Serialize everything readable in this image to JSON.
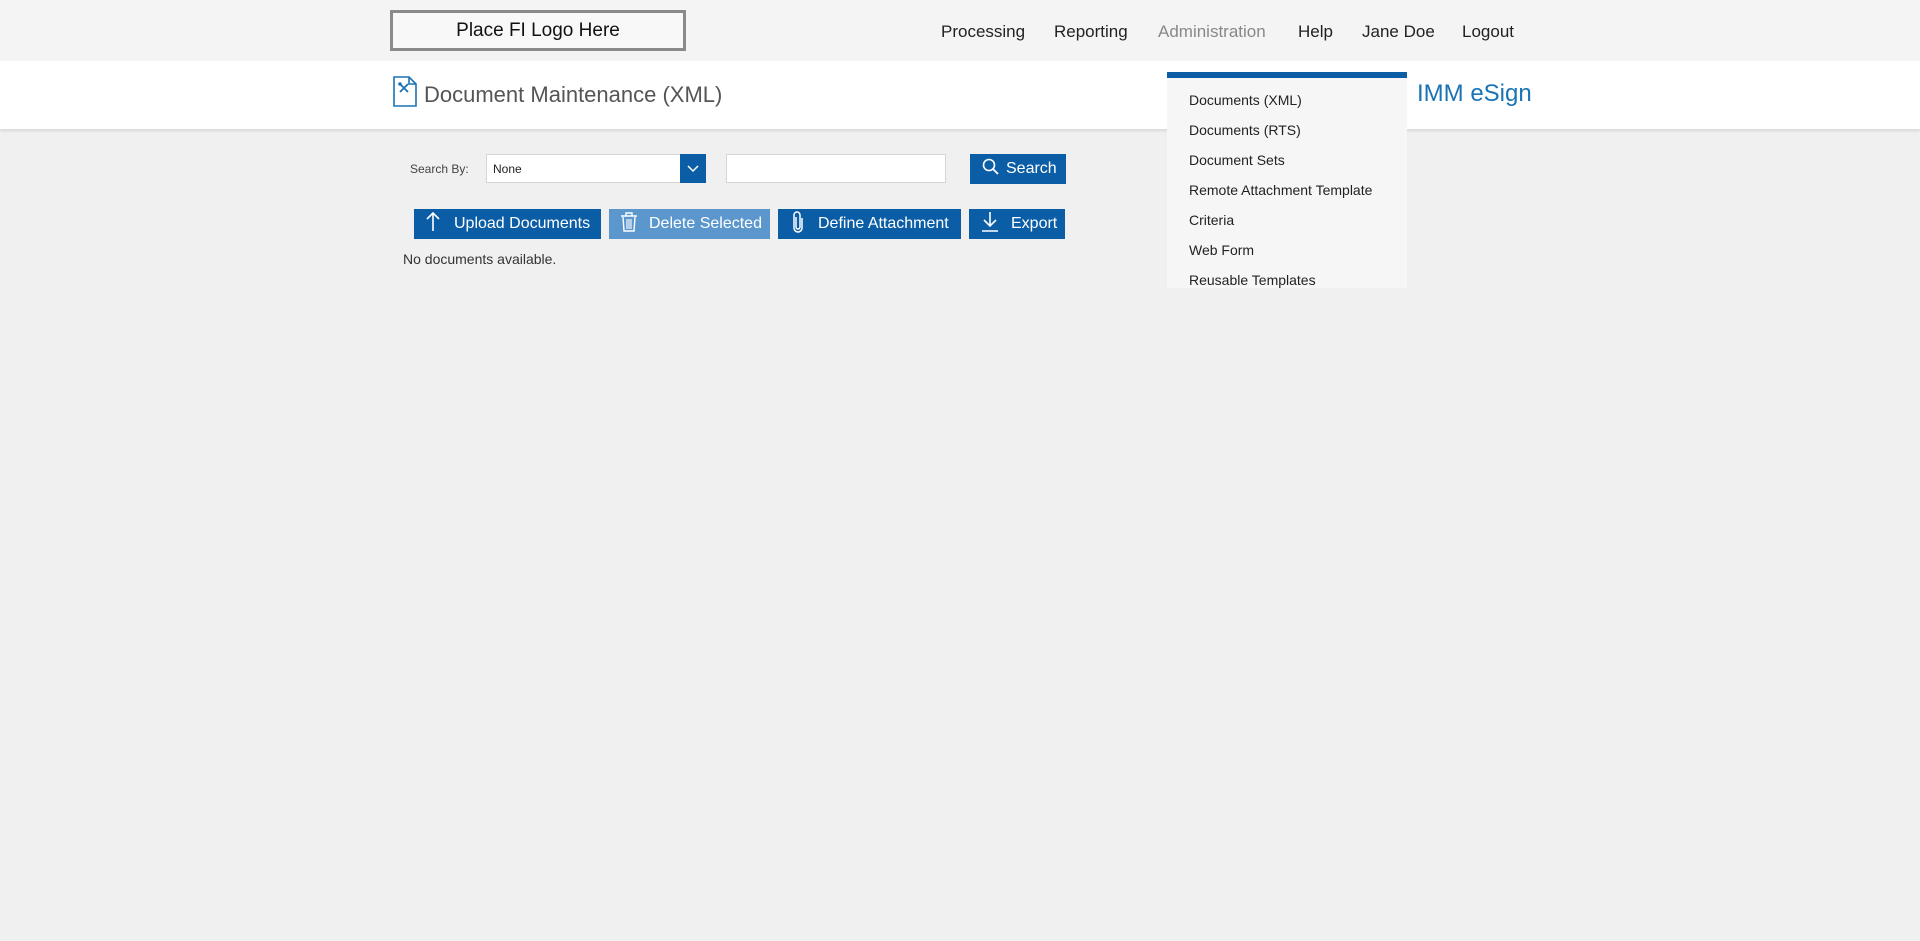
{
  "header": {
    "logo_text": "Place FI Logo Here",
    "nav": [
      {
        "label": "Processing"
      },
      {
        "label": "Reporting"
      },
      {
        "label": "Administration",
        "active": true
      },
      {
        "label": "Help"
      },
      {
        "label": "Jane Doe"
      },
      {
        "label": "Logout"
      }
    ]
  },
  "title_bar": {
    "page_title": "Document Maintenance (XML)",
    "icon": "document-wrench-icon",
    "brand": "IMM eSign"
  },
  "search": {
    "label": "Search By:",
    "selected_value": "None",
    "input_value": "",
    "button_label": "Search"
  },
  "toolbar": {
    "upload_label": "Upload Documents",
    "delete_label": "Delete Selected",
    "define_label": "Define Attachment",
    "export_label": "Export"
  },
  "content": {
    "empty_message": "No documents available."
  },
  "admin_menu": {
    "items": [
      {
        "label": "Documents (XML)"
      },
      {
        "label": "Documents (RTS)"
      },
      {
        "label": "Document Sets"
      },
      {
        "label": "Remote Attachment Template"
      },
      {
        "label": "Criteria"
      },
      {
        "label": "Web Form"
      },
      {
        "label": "Reusable Templates"
      }
    ]
  },
  "colors": {
    "accent": "#0b5ea6",
    "brand_text": "#1a73b4",
    "disabled_button": "#5b97cd",
    "page_background": "#f0f0f0"
  }
}
